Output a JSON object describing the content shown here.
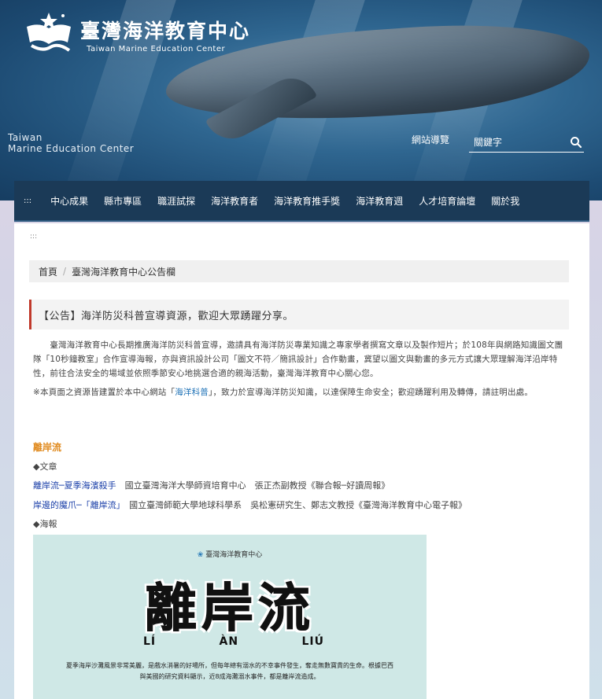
{
  "header": {
    "logo_title": "臺灣海洋教育中心",
    "logo_subtitle": "Taiwan Marine Education Center",
    "side_brand_line1": "Taiwan",
    "side_brand_line2": "Marine Education Center",
    "sitemap_label": "網站導覽",
    "search_placeholder": "關鍵字"
  },
  "nav": {
    "accesskey": ":::",
    "items": [
      "中心成果",
      "縣市專區",
      "職涯試探",
      "海洋教育者",
      "海洋教育推手獎",
      "海洋教育週",
      "人才培育論壇",
      "關於我"
    ]
  },
  "main": {
    "accesskey": ":::",
    "breadcrumb": {
      "home": "首頁",
      "current": "臺灣海洋教育中心公告欄"
    },
    "notice_title": "【公告】海洋防災科普宣導資源，歡迎大眾踴躍分享。",
    "para1": "　　臺灣海洋教育中心長期推廣海洋防災科普宣導，邀請具有海洋防災專業知識之專家學者撰寫文章以及製作短片；於108年與網路知識圖文團隊「10秒鐘教室」合作宣導海報，亦與資訊設計公司「圖文不符／簡訊設計」合作動畫，冀望以圖文與動畫的多元方式讓大眾理解海洋沿岸特性，前往合法安全的場域並依照季節安心地挑選合適的親海活動，臺灣海洋教育中心關心您。",
    "para2_prefix": "※本頁面之資源皆建置於本中心網站「",
    "para2_link": "海洋科普",
    "para2_suffix": "」，致力於宣導海洋防災知識，以達保障生命安全；歡迎踴躍利用及轉傳，請註明出處。",
    "section_title": "離岸流",
    "articles_label": "◆文章",
    "article1_link": "離岸流─夏季海濱殺手",
    "article1_meta": "　國立臺灣海洋大學師資培育中心　張正杰副教授《聯合報─好讀周報》",
    "article2_link": "岸邊的魔爪─「離岸流」",
    "article2_meta": "　國立臺灣師範大學地球科學系　吳松憲研究生、鄭志文教授《臺灣海洋教育中心電子報》",
    "poster_label": "◆海報",
    "poster": {
      "org": "臺灣海洋教育中心",
      "title": "離岸流",
      "pinyin": [
        "LÍ",
        "ÀN",
        "LIÚ"
      ],
      "desc": "夏季海岸沙灘風景非常美麗，是戲水消暑的好場所，但每年總有溺水的不幸事件發生，奪走無數寶貴的生命。根據巴西與美國的研究資料顯示，近8成海灘溺水事件，都是離岸流造成。"
    }
  },
  "colors": {
    "nav_bg": "#1b3a57",
    "notice_accent": "#c0392b",
    "section_title": "#e08a1e",
    "link": "#1a3fa8",
    "poster_bg": "#cfe8e6"
  }
}
